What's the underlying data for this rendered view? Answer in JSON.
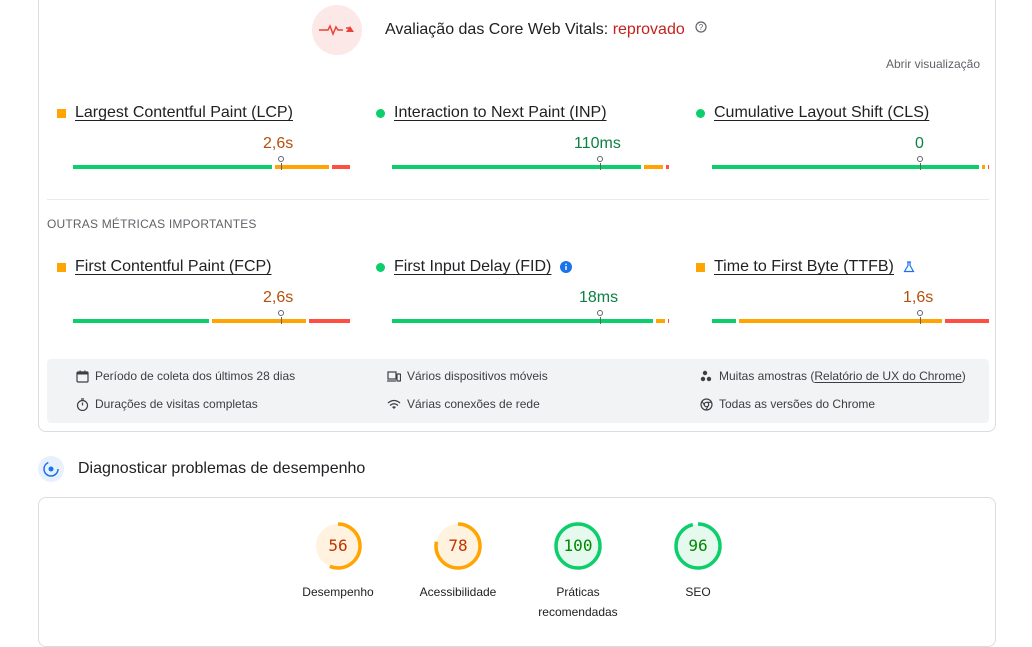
{
  "header": {
    "title": "Avaliação das Core Web Vitals:",
    "status": "reprovado",
    "open_view": "Abrir visualização"
  },
  "core_metrics": [
    {
      "name": "Largest Contentful Paint (LCP)",
      "value": "2,6s",
      "rating": "average"
    },
    {
      "name": "Interaction to Next Paint (INP)",
      "value": "110ms",
      "rating": "good"
    },
    {
      "name": "Cumulative Layout Shift (CLS)",
      "value": "0",
      "rating": "good"
    }
  ],
  "other_metrics_label": "OUTRAS MÉTRICAS IMPORTANTES",
  "other_metrics": [
    {
      "name": "First Contentful Paint (FCP)",
      "value": "2,6s",
      "rating": "average"
    },
    {
      "name": "First Input Delay (FID)",
      "value": "18ms",
      "rating": "good"
    },
    {
      "name": "Time to First Byte (TTFB)",
      "value": "1,6s",
      "rating": "average"
    }
  ],
  "info": {
    "period": "Período de coleta dos últimos 28 dias",
    "visits": "Durações de visitas completas",
    "devices": "Vários dispositivos móveis",
    "network": "Várias conexões de rede",
    "samples_prefix": "Muitas amostras (",
    "samples_link": "Relatório de UX do Chrome",
    "samples_suffix": ")",
    "chrome": "Todas as versões do Chrome"
  },
  "diagnose_title": "Diagnosticar problemas de desempenho",
  "scores": [
    {
      "label": "Desempenho",
      "value": "56",
      "score": 56,
      "color": "#ffa400",
      "text_color": "#c33300",
      "bg": "#fff3e0"
    },
    {
      "label": "Acessibilidade",
      "value": "78",
      "score": 78,
      "color": "#ffa400",
      "text_color": "#c33300",
      "bg": "#fff3e0"
    },
    {
      "label": "Práticas recomendadas",
      "value": "100",
      "score": 100,
      "color": "#0cce6b",
      "text_color": "#008800",
      "bg": "#e6f9ee"
    },
    {
      "label": "SEO",
      "value": "96",
      "score": 96,
      "color": "#0cce6b",
      "text_color": "#008800",
      "bg": "#e6f9ee"
    }
  ],
  "colors": {
    "good": "#0cce6b",
    "average": "#ffa400",
    "poor": "#ff4e42",
    "fail": "#c5221f"
  }
}
